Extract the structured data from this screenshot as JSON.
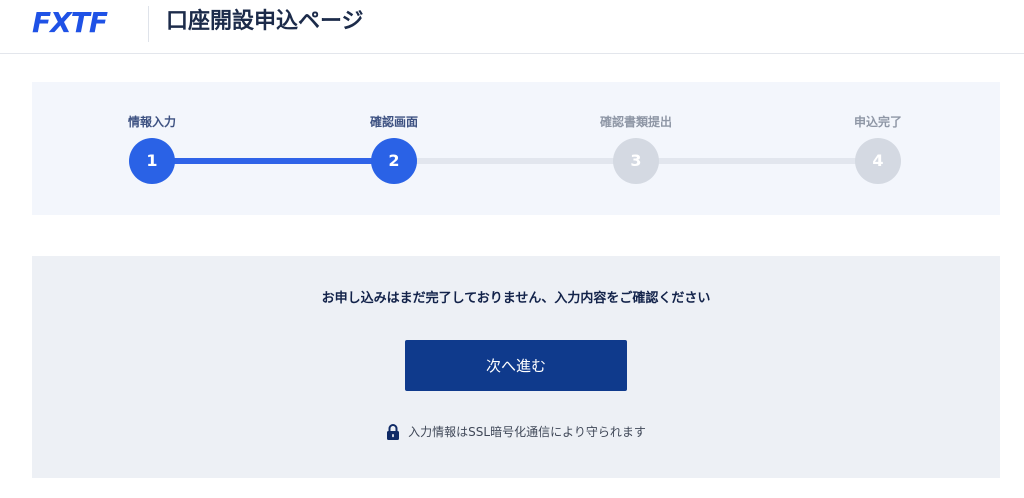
{
  "header": {
    "logo_text": "FXTF",
    "title": "口座開設申込ページ"
  },
  "steps": [
    {
      "label": "情報入力",
      "number": "1",
      "state": "active"
    },
    {
      "label": "確認画面",
      "number": "2",
      "state": "active"
    },
    {
      "label": "確認書類提出",
      "number": "3",
      "state": "inactive"
    },
    {
      "label": "申込完了",
      "number": "4",
      "state": "inactive"
    }
  ],
  "main": {
    "notice": "お申し込みはまだ完了しておりません、入力内容をご確認ください",
    "next_button_label": "次へ進む",
    "ssl_text": "入力情報はSSL暗号化通信により守られます"
  },
  "colors": {
    "brand": "#1f52e6",
    "active_step": "#2a62e6",
    "inactive_step": "#d4d9e2",
    "button": "#0f3a8c"
  },
  "icons": {
    "lock": "lock-icon"
  }
}
